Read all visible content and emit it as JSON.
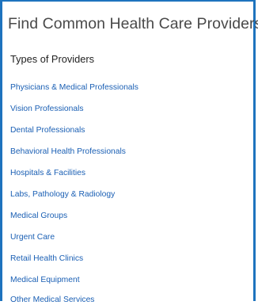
{
  "panel": {
    "title": "Find Common Health Care Providers",
    "section_heading": "Types of Providers",
    "accent_color": "#1e73be",
    "link_color": "#1a5fb4"
  },
  "provider_types": [
    {
      "label": "Physicians & Medical Professionals"
    },
    {
      "label": "Vision Professionals"
    },
    {
      "label": "Dental Professionals"
    },
    {
      "label": "Behavioral Health Professionals"
    },
    {
      "label": "Hospitals & Facilities"
    },
    {
      "label": "Labs, Pathology & Radiology"
    },
    {
      "label": "Medical Groups"
    },
    {
      "label": "Urgent Care"
    },
    {
      "label": "Retail Health Clinics"
    },
    {
      "label": "Medical Equipment"
    },
    {
      "label": "Other Medical Services"
    }
  ]
}
